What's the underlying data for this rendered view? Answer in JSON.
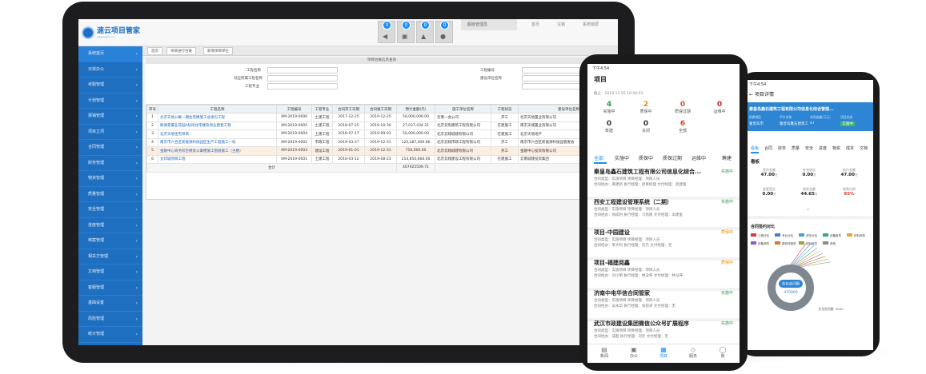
{
  "desktop": {
    "logo": {
      "title": "速云项目管家",
      "subtitle": "www.suyun.cn"
    },
    "notifications": [
      {
        "count": "0",
        "icon": "speaker-icon"
      },
      {
        "count": "0",
        "icon": "trash-icon"
      },
      {
        "count": "0",
        "icon": "warning-icon"
      },
      {
        "count": "0",
        "icon": "user-icon"
      }
    ],
    "top_links": {
      "user": "超级管理员",
      "home": "首页",
      "logout": "注销",
      "lock": "系统锁屏"
    },
    "sidebar": [
      "系统首页",
      "日常办公",
      "考勤管理",
      "计划管理",
      "报销管理",
      "项目立项",
      "合同管理",
      "财务管理",
      "物资管理",
      "质量管理",
      "安全管理",
      "进度管理",
      "档案管理",
      "相关方管理",
      "文档管理",
      "客服管理",
      "基础设置",
      "风险管理",
      "统计管理",
      "流程管理"
    ],
    "tabs": [
      "首页",
      "项目进行台账",
      "新增项目单位"
    ],
    "filter": {
      "bar_title": "项目台账信息查询",
      "query_button": "查询",
      "labels": {
        "name": "工程名称",
        "owner": "对应所属工程名称",
        "pm": "工程专业",
        "code": "工程编号",
        "unit": "建设单位名称"
      }
    },
    "table": {
      "headers": [
        "序号",
        "工程名称",
        "工程编号",
        "工程专业",
        "合同开工日期",
        "合同竣工日期",
        "预计金额(元)",
        "施工单位名称",
        "工程状态",
        "建设单位名称"
      ],
      "rows": [
        [
          "1",
          "北京天地公寓一期住宅楼施工总承包工程",
          "XM-2019-0006",
          "土建工程",
          "2017-12-25",
          "2019-12-25",
          "50,000,000.00",
          "云南一会公司",
          "开工",
          "北京天地置业有限公司"
        ],
        [
          "2",
          "鲜湖景置业花园A标段住宅楼及商业配套工程",
          "XM-2019-0005",
          "土建工程",
          "2018-07-25",
          "2019-10-30",
          "27,037,434.21",
          "北京云阳建筑工程有限公司",
          "在建施工",
          "南京天城置业有限公司"
        ],
        [
          "3",
          "北京天地住宅项目",
          "XM-2019-0004",
          "土建工程",
          "2016-07-17",
          "2019-09-01",
          "50,000,000.00",
          "北京云翔城建有限公司",
          "在建施工",
          "北京天地地产"
        ],
        [
          "4",
          "南京市六合区新能源科技园区生产工程施工一标",
          "XM-2019-0002",
          "市政工程",
          "2019-03-27",
          "2019-12-31",
          "125,287,409.66",
          "北京云翔市政工程有限公司",
          "开工",
          "南京市六合区新能源科技园管委会"
        ],
        [
          "5",
          "金融中心商务综合楼及公寓楼施工图纸施工（主楼）",
          "XM-2019-0003",
          "建设工程",
          "2019-01-01",
          "2019-12-31",
          "750,000.00",
          "北京云翔城建有限公司",
          "开工",
          "金融中心投资有限公司"
        ],
        [
          "6",
          "文印城项目工程",
          "XM-2019-0001",
          "土建工程",
          "2018-03-12",
          "2019-08-23",
          "214,850,666.00",
          "北京云翔建设工程有限公司",
          "在建施工",
          "云南城建投资集团"
        ]
      ],
      "total_label": "合计",
      "total_value": "467925509.71"
    }
  },
  "phone1": {
    "status_time": "下午4:54",
    "header_title": "项目",
    "date_line": "截止：2019-11-25 16:54:03",
    "stats": [
      {
        "n": "4",
        "l": "实施中",
        "c": "#2a9d4a"
      },
      {
        "n": "2",
        "l": "质保中",
        "c": "#e58a00"
      },
      {
        "n": "0",
        "l": "质保过期",
        "c": "#e04a2a"
      },
      {
        "n": "0",
        "l": "运维中",
        "c": "#c8282e"
      },
      {
        "n": "0",
        "l": "筹建",
        "c": "#333333"
      },
      {
        "n": "0",
        "l": "关闭",
        "c": "#333333"
      },
      {
        "n": "6",
        "l": "全部",
        "c": "#e04a2a"
      }
    ],
    "tabs": [
      "全部",
      "实施中",
      "质保中",
      "质保过期",
      "运维中",
      "筹建"
    ],
    "projects": [
      {
        "title": "秦皇岛鑫石建筑工程有限公司信息化综合...",
        "status": "实施中",
        "sc": "#2a9d4a",
        "m1": "合同类型：实施项目   项目经理：项目人员",
        "m2": "合同经办：黄建新   执行经理：项目经理   文付经理：高建富"
      },
      {
        "title": "西安工程建设管理系统（二期）",
        "status": "实施中",
        "sc": "#2a9d4a",
        "m1": "合同类型：实施项目   项目经理：项目人员",
        "m2": "合同经办：徐成利   执行经理：习尚丽   文付经理：高建富"
      },
      {
        "title": "项目-中园建设",
        "status": "质保中",
        "sc": "#e58a00",
        "m1": "合同类型：实施项目   项目经理：项目人员",
        "m2": "合同经办：李大利   执行经理：刘元   文付经理：无"
      },
      {
        "title": "项目-福建阅鑫",
        "status": "质保中",
        "sc": "#e58a00",
        "m1": "合同类型：实施项目   项目经理：项目人员",
        "m2": "合同经办：刘小明   执行经理：林汾坤   文付经理：林汾坤"
      },
      {
        "title": "济南中电华信合同管家",
        "status": "实施中",
        "sc": "#2a9d4a",
        "m1": "合同类型：实施项目   项目经理：项目人员",
        "m2": "合同经办：吴永华   执行经理：张宿涛   文付经理：无"
      },
      {
        "title": "武汉市政建设集团微信公众号扩展程序",
        "status": "实施中",
        "sc": "#2a9d4a",
        "m1": "合同类型：实施项目   项目经理：项目人员",
        "m2": "合同经办：成超   执行经理：刘元   文付经理：无"
      }
    ],
    "nav": [
      "新闻",
      "办公",
      "项目",
      "服务",
      "我"
    ]
  },
  "phone2": {
    "status_time": "下午4:54",
    "header_title": "项目详情",
    "company": "秦皇岛鑫石建筑工程有限公司信息化综合管理...",
    "info_labels": [
      "所属地区",
      "甲方名称",
      "合同金额(万元)",
      "项目状态"
    ],
    "info_values": [
      "秦皇岛市",
      "秦皇岛鑫石建筑工...",
      "47",
      "实施中"
    ],
    "tabs": [
      "看板",
      "合同",
      "财务",
      "质量",
      "安全",
      "进度",
      "物资",
      "成本",
      "文档"
    ],
    "board_title": "看板",
    "kpis": [
      {
        "l": "签约金额",
        "v": "47.00",
        "u": "万"
      },
      {
        "l": "补充协议",
        "v": "0.00",
        "u": "万"
      },
      {
        "l": "执行金额",
        "v": "47.00",
        "u": "万"
      },
      {
        "l": "变更签证",
        "v": "0.00",
        "u": "万"
      },
      {
        "l": "收款金额",
        "v": "44.65",
        "u": "万"
      },
      {
        "l": "收款比例",
        "v": "95%",
        "u": ""
      }
    ],
    "chart_title": "合同签约对比",
    "chart_data": {
      "type": "pie",
      "legend": [
        "工程分包",
        "专业分包",
        "劳务分包",
        "设备租赁",
        "材料采购",
        "设备采购",
        "周转材租赁",
        "材料租赁",
        "其他"
      ],
      "center_label": "总包合同额",
      "center_value": "470000",
      "annotation": "总包合同额: 3000"
    },
    "colors": [
      "#d83a3a",
      "#4a7bd2",
      "#4aa3c8",
      "#3aa874",
      "#e2a83a",
      "#8e5bc7",
      "#d8782e",
      "#9aa23a",
      "#8a8a8a"
    ]
  }
}
